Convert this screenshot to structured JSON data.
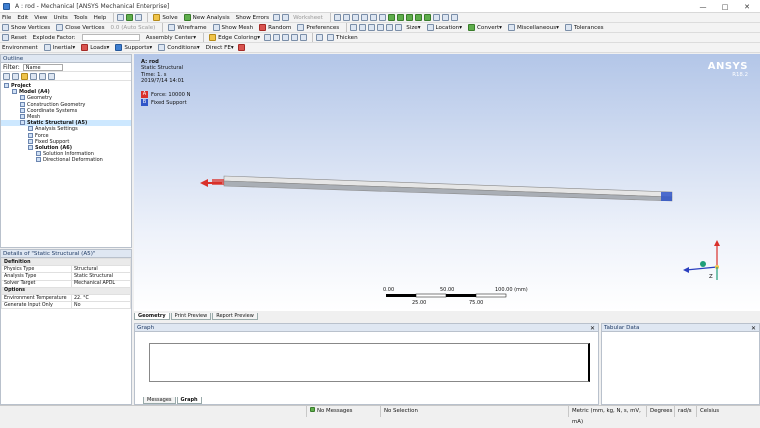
{
  "window": {
    "title": "A : rod - Mechanical [ANSYS Mechanical Enterprise]"
  },
  "menu": [
    "File",
    "Edit",
    "View",
    "Units",
    "Tools",
    "Help"
  ],
  "toolbar1": {
    "solve": "Solve",
    "new_analysis": "New Analysis",
    "show_errors": "Show Errors",
    "worksheet": "Worksheet"
  },
  "toolbar2": {
    "show_vertices": "Show Vertices",
    "close_vertices": "Close Vertices",
    "auto_scale": "0.0 (Auto Scale)",
    "wireframe": "Wireframe",
    "show_mesh": "Show Mesh",
    "random": "Random",
    "preferences": "Preferences",
    "size": "Size",
    "location": "Location",
    "convert": "Convert",
    "misc": "Miscellaneous",
    "tolerances": "Tolerances"
  },
  "toolbar3": {
    "reset": "Reset",
    "explode": "Explode Factor:",
    "assembly_center": "Assembly Center",
    "edge_coloring": "Edge Coloring",
    "thicken": "Thicken"
  },
  "toolbar4": {
    "environment": "Environment",
    "inertial": "Inertial",
    "loads": "Loads",
    "supports": "Supports",
    "conditions": "Conditions",
    "direct_fe": "Direct FE"
  },
  "outline": {
    "title": "Outline",
    "filter_label": "Filter:",
    "filter_value": "Name",
    "items": [
      {
        "label": "Project",
        "indent": 0
      },
      {
        "label": "Model (A4)",
        "indent": 1
      },
      {
        "label": "Geometry",
        "indent": 2
      },
      {
        "label": "Construction Geometry",
        "indent": 2
      },
      {
        "label": "Coordinate Systems",
        "indent": 2
      },
      {
        "label": "Mesh",
        "indent": 2
      },
      {
        "label": "Static Structural (A5)",
        "indent": 2,
        "selected": true
      },
      {
        "label": "Analysis Settings",
        "indent": 3
      },
      {
        "label": "Force",
        "indent": 3
      },
      {
        "label": "Fixed Support",
        "indent": 3
      },
      {
        "label": "Solution (A6)",
        "indent": 3
      },
      {
        "label": "Solution Information",
        "indent": 4
      },
      {
        "label": "Directional Deformation",
        "indent": 4
      }
    ]
  },
  "details": {
    "title": "Details of \"Static Structural (A5)\"",
    "rows": [
      {
        "type": "group",
        "label": "Definition"
      },
      {
        "label": "Physics Type",
        "value": "Structural"
      },
      {
        "label": "Analysis Type",
        "value": "Static Structural"
      },
      {
        "label": "Solver Target",
        "value": "Mechanical APDL"
      },
      {
        "type": "group",
        "label": "Options"
      },
      {
        "label": "Environment Temperature",
        "value": "22. °C"
      },
      {
        "label": "Generate Input Only",
        "value": "No"
      }
    ]
  },
  "viewport": {
    "analysis": "A: rod",
    "type": "Static Structural",
    "time": "Time: 1. s",
    "date": "2019/7/14 14:01",
    "legend": [
      {
        "letter": "A",
        "label": "Force: 10000 N",
        "color": "#d9302a"
      },
      {
        "letter": "B",
        "label": "Fixed Support",
        "color": "#2f55c8"
      }
    ],
    "logo": "ANSYS",
    "version": "R18.2",
    "scale_top": [
      "0.00",
      "50.00",
      "100.00 (mm)"
    ],
    "scale_bottom": [
      "25.00",
      "75.00"
    ],
    "axis_z": "Z"
  },
  "view_tabs": [
    "Geometry",
    "Print Preview",
    "Report Preview"
  ],
  "graph": {
    "title": "Graph"
  },
  "tabular": {
    "title": "Tabular Data"
  },
  "bottom_tabs": [
    "Messages",
    "Graph"
  ],
  "status": {
    "messages": "No Messages",
    "selection": "No Selection",
    "units": "Metric (mm, kg, N, s, mV, mA)",
    "angle": "Degrees",
    "rate": "rad/s",
    "temp": "Celsius"
  }
}
